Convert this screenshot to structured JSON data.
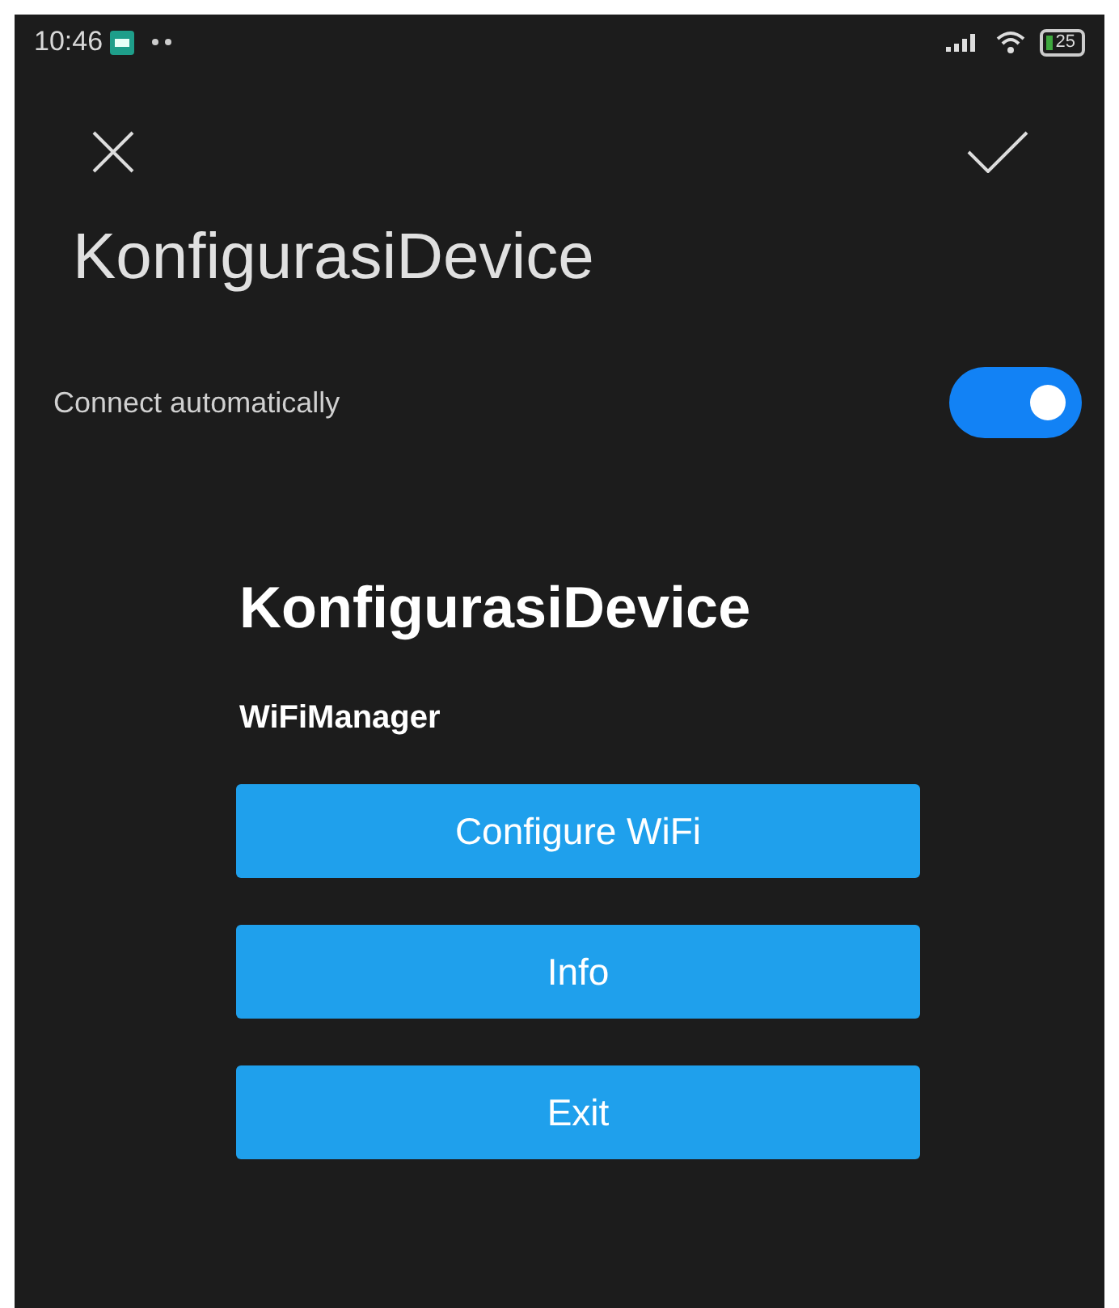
{
  "status_bar": {
    "time": "10:46",
    "battery": "25"
  },
  "header": {
    "title": "KonfigurasiDevice"
  },
  "auto_connect": {
    "label": "Connect automatically",
    "on": true
  },
  "portal": {
    "title": "KonfigurasiDevice",
    "subtitle": "WiFiManager",
    "buttons": [
      "Configure WiFi",
      "Info",
      "Exit"
    ]
  }
}
